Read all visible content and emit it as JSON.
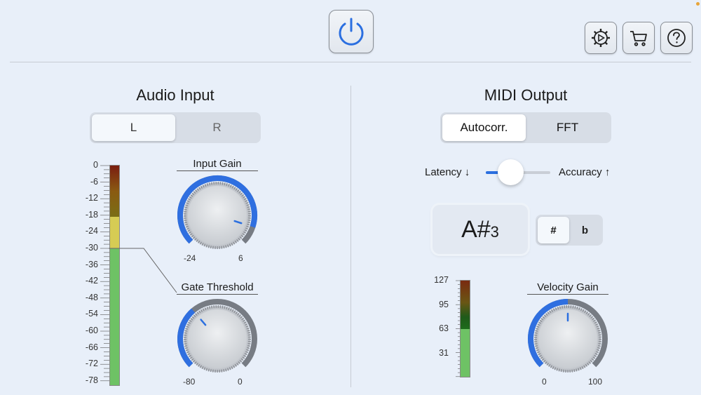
{
  "header": {
    "power_icon": "power-icon",
    "settings_icon": "gear-play-icon",
    "cart_icon": "cart-icon",
    "help_icon": "help-icon",
    "accent": "#2b6fe0"
  },
  "audio_input": {
    "title": "Audio Input",
    "channels": [
      "L",
      "R"
    ],
    "selected_channel": "L",
    "meter_scale": [
      "0",
      "-6",
      "-12",
      "-18",
      "-24",
      "-30",
      "-36",
      "-42",
      "-48",
      "-54",
      "-60",
      "-66",
      "-72",
      "-78"
    ],
    "input_gain": {
      "label": "Input Gain",
      "min": "-24",
      "max": "6"
    },
    "gate_threshold": {
      "label": "Gate Threshold",
      "min": "-80",
      "max": "0",
      "level_marker": "-30"
    }
  },
  "midi_output": {
    "title": "MIDI Output",
    "modes": [
      "Autocorr.",
      "FFT"
    ],
    "selected_mode": "Autocorr.",
    "latency_label": "Latency ↓",
    "accuracy_label": "Accuracy ↑",
    "note": "A#",
    "note_octave": "3",
    "accidentals": [
      "#",
      "b"
    ],
    "selected_accidental": "#",
    "velocity_scale": [
      "127",
      "95",
      "63",
      "31"
    ],
    "velocity_gain": {
      "label": "Velocity Gain",
      "min": "0",
      "max": "100"
    }
  }
}
